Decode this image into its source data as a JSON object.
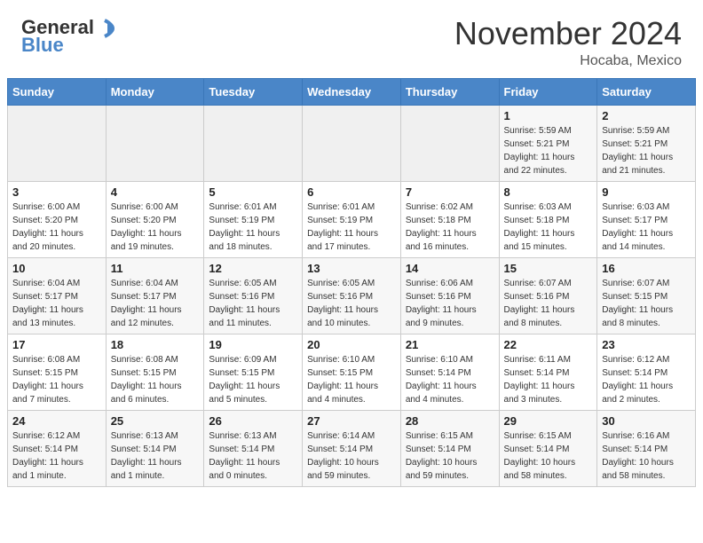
{
  "header": {
    "logo_line1": "General",
    "logo_line2": "Blue",
    "month": "November 2024",
    "location": "Hocaba, Mexico"
  },
  "weekdays": [
    "Sunday",
    "Monday",
    "Tuesday",
    "Wednesday",
    "Thursday",
    "Friday",
    "Saturday"
  ],
  "weeks": [
    [
      {
        "day": "",
        "info": ""
      },
      {
        "day": "",
        "info": ""
      },
      {
        "day": "",
        "info": ""
      },
      {
        "day": "",
        "info": ""
      },
      {
        "day": "",
        "info": ""
      },
      {
        "day": "1",
        "info": "Sunrise: 5:59 AM\nSunset: 5:21 PM\nDaylight: 11 hours\nand 22 minutes."
      },
      {
        "day": "2",
        "info": "Sunrise: 5:59 AM\nSunset: 5:21 PM\nDaylight: 11 hours\nand 21 minutes."
      }
    ],
    [
      {
        "day": "3",
        "info": "Sunrise: 6:00 AM\nSunset: 5:20 PM\nDaylight: 11 hours\nand 20 minutes."
      },
      {
        "day": "4",
        "info": "Sunrise: 6:00 AM\nSunset: 5:20 PM\nDaylight: 11 hours\nand 19 minutes."
      },
      {
        "day": "5",
        "info": "Sunrise: 6:01 AM\nSunset: 5:19 PM\nDaylight: 11 hours\nand 18 minutes."
      },
      {
        "day": "6",
        "info": "Sunrise: 6:01 AM\nSunset: 5:19 PM\nDaylight: 11 hours\nand 17 minutes."
      },
      {
        "day": "7",
        "info": "Sunrise: 6:02 AM\nSunset: 5:18 PM\nDaylight: 11 hours\nand 16 minutes."
      },
      {
        "day": "8",
        "info": "Sunrise: 6:03 AM\nSunset: 5:18 PM\nDaylight: 11 hours\nand 15 minutes."
      },
      {
        "day": "9",
        "info": "Sunrise: 6:03 AM\nSunset: 5:17 PM\nDaylight: 11 hours\nand 14 minutes."
      }
    ],
    [
      {
        "day": "10",
        "info": "Sunrise: 6:04 AM\nSunset: 5:17 PM\nDaylight: 11 hours\nand 13 minutes."
      },
      {
        "day": "11",
        "info": "Sunrise: 6:04 AM\nSunset: 5:17 PM\nDaylight: 11 hours\nand 12 minutes."
      },
      {
        "day": "12",
        "info": "Sunrise: 6:05 AM\nSunset: 5:16 PM\nDaylight: 11 hours\nand 11 minutes."
      },
      {
        "day": "13",
        "info": "Sunrise: 6:05 AM\nSunset: 5:16 PM\nDaylight: 11 hours\nand 10 minutes."
      },
      {
        "day": "14",
        "info": "Sunrise: 6:06 AM\nSunset: 5:16 PM\nDaylight: 11 hours\nand 9 minutes."
      },
      {
        "day": "15",
        "info": "Sunrise: 6:07 AM\nSunset: 5:16 PM\nDaylight: 11 hours\nand 8 minutes."
      },
      {
        "day": "16",
        "info": "Sunrise: 6:07 AM\nSunset: 5:15 PM\nDaylight: 11 hours\nand 8 minutes."
      }
    ],
    [
      {
        "day": "17",
        "info": "Sunrise: 6:08 AM\nSunset: 5:15 PM\nDaylight: 11 hours\nand 7 minutes."
      },
      {
        "day": "18",
        "info": "Sunrise: 6:08 AM\nSunset: 5:15 PM\nDaylight: 11 hours\nand 6 minutes."
      },
      {
        "day": "19",
        "info": "Sunrise: 6:09 AM\nSunset: 5:15 PM\nDaylight: 11 hours\nand 5 minutes."
      },
      {
        "day": "20",
        "info": "Sunrise: 6:10 AM\nSunset: 5:15 PM\nDaylight: 11 hours\nand 4 minutes."
      },
      {
        "day": "21",
        "info": "Sunrise: 6:10 AM\nSunset: 5:14 PM\nDaylight: 11 hours\nand 4 minutes."
      },
      {
        "day": "22",
        "info": "Sunrise: 6:11 AM\nSunset: 5:14 PM\nDaylight: 11 hours\nand 3 minutes."
      },
      {
        "day": "23",
        "info": "Sunrise: 6:12 AM\nSunset: 5:14 PM\nDaylight: 11 hours\nand 2 minutes."
      }
    ],
    [
      {
        "day": "24",
        "info": "Sunrise: 6:12 AM\nSunset: 5:14 PM\nDaylight: 11 hours\nand 1 minute."
      },
      {
        "day": "25",
        "info": "Sunrise: 6:13 AM\nSunset: 5:14 PM\nDaylight: 11 hours\nand 1 minute."
      },
      {
        "day": "26",
        "info": "Sunrise: 6:13 AM\nSunset: 5:14 PM\nDaylight: 11 hours\nand 0 minutes."
      },
      {
        "day": "27",
        "info": "Sunrise: 6:14 AM\nSunset: 5:14 PM\nDaylight: 10 hours\nand 59 minutes."
      },
      {
        "day": "28",
        "info": "Sunrise: 6:15 AM\nSunset: 5:14 PM\nDaylight: 10 hours\nand 59 minutes."
      },
      {
        "day": "29",
        "info": "Sunrise: 6:15 AM\nSunset: 5:14 PM\nDaylight: 10 hours\nand 58 minutes."
      },
      {
        "day": "30",
        "info": "Sunrise: 6:16 AM\nSunset: 5:14 PM\nDaylight: 10 hours\nand 58 minutes."
      }
    ]
  ]
}
